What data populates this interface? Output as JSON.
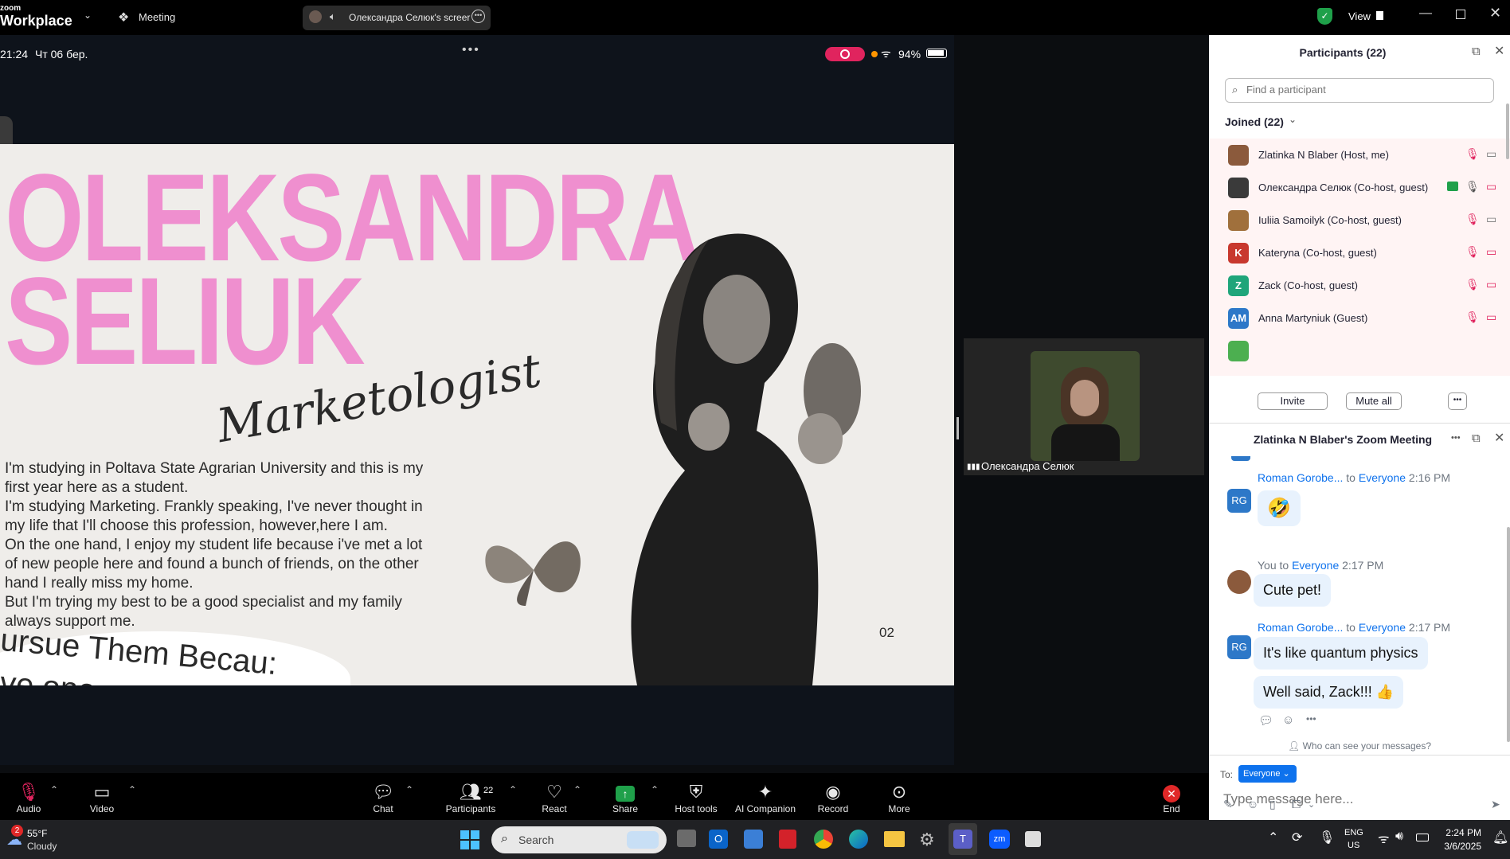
{
  "app": {
    "brand_line1": "zoom",
    "brand_line2": "Workplace",
    "meeting_label": "Meeting",
    "share_title": "Олександра Селюк's screer",
    "view_label": "View"
  },
  "phone_status": {
    "time": "21:24",
    "date": "Чт 06 бер.",
    "battery": "94%"
  },
  "slide": {
    "name_line1": "OLEKSANDRA",
    "name_line2": "SELIUK",
    "script_title": "Marketologist",
    "body": [
      "I'm studying in Poltava State Agrarian University and this is my",
      "first year here as a student.",
      "I'm studying Marketing. Frankly speaking, I've never thought in",
      "my life that I'll choose this profession, however,here I am.",
      "On the one hand, I enjoy my student life because i've met a lot",
      "of new people here and found a bunch of friends, on the other",
      "hand I really miss my home.",
      "But I'm trying my best to be a good specialist and my family",
      "always support me."
    ],
    "curve_text_1": "ursue Them Becau:",
    "curve_text_2": "ve one",
    "page_num": "02",
    "colors": {
      "pink": "#ef8fcf",
      "bg": "#efedea"
    }
  },
  "video_tile": {
    "name": "Олександра Селюк"
  },
  "participants": {
    "title": "Participants (22)",
    "search_placeholder": "Find a participant",
    "joined_label": "Joined (22)",
    "list": [
      {
        "initials": "",
        "name": "Zlatinka N Blaber (Host, me)",
        "color": "#8b5a3c"
      },
      {
        "initials": "",
        "name": "Олександра Селюк (Co-host, guest)",
        "color": "#3a3a3a"
      },
      {
        "initials": "",
        "name": "Iuliia Samoilyk (Co-host, guest)",
        "color": "#a0703c"
      },
      {
        "initials": "K",
        "name": "Kateryna (Co-host, guest)",
        "color": "#c8382e"
      },
      {
        "initials": "Z",
        "name": "Zack (Co-host, guest)",
        "color": "#1fa57a"
      },
      {
        "initials": "AM",
        "name": "Anna Martyniuk (Guest)",
        "color": "#2d78c8"
      }
    ],
    "invite_label": "Invite",
    "mute_all_label": "Mute all"
  },
  "chat": {
    "title": "Zlatinka N Blaber's Zoom Meeting",
    "messages": [
      {
        "avatar": "RG",
        "sender": "Roman Gorobe...",
        "to_word": "to",
        "recipient": "Everyone",
        "time": "2:16 PM",
        "text": "🤣"
      },
      {
        "avatar": "",
        "sender": "You",
        "to_word": "to",
        "recipient": "Everyone",
        "time": "2:17 PM",
        "text": "Cute pet!"
      },
      {
        "avatar": "RG",
        "sender": "Roman Gorobe...",
        "to_word": "to",
        "recipient": "Everyone",
        "time": "2:17 PM",
        "text": "It's like quantum physics",
        "text2": "Well said, Zack!!! 👍"
      }
    ],
    "who_can_see": "Who can see your messages?",
    "to_label": "To:",
    "to_value": "Everyone",
    "input_placeholder": "Type message here..."
  },
  "toolbar": {
    "audio": "Audio",
    "video": "Video",
    "chat": "Chat",
    "participants": "Participants",
    "participants_count": "22",
    "react": "React",
    "share": "Share",
    "host_tools": "Host tools",
    "ai_companion": "AI Companion",
    "record": "Record",
    "more": "More",
    "end": "End"
  },
  "taskbar": {
    "weather_temp": "55°F",
    "weather_desc": "Cloudy",
    "weather_badge": "2",
    "search": "Search",
    "lang1": "ENG",
    "lang2": "US",
    "time": "2:24 PM",
    "date": "3/6/2025"
  }
}
